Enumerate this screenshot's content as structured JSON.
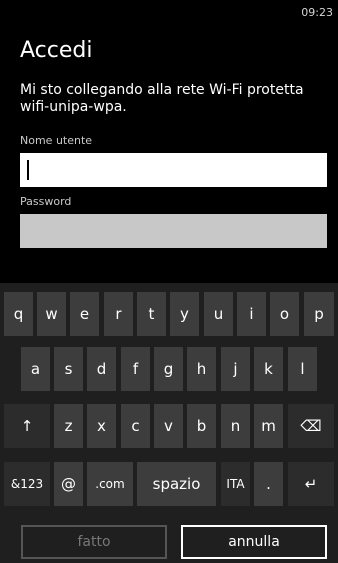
{
  "status": {
    "time": "09:23"
  },
  "title": "Accedi",
  "message": "Mi sto collegando alla rete Wi-Fi protetta wifi-unipa-wpa.",
  "username": {
    "label": "Nome utente",
    "value": ""
  },
  "password": {
    "label": "Password",
    "value": ""
  },
  "keyboard": {
    "row1": [
      "q",
      "w",
      "e",
      "r",
      "t",
      "y",
      "u",
      "i",
      "o",
      "p"
    ],
    "row2": [
      "a",
      "s",
      "d",
      "f",
      "g",
      "h",
      "j",
      "k",
      "l"
    ],
    "row3": [
      "z",
      "x",
      "c",
      "v",
      "b",
      "n",
      "m"
    ],
    "shift": "↑",
    "backspace": "⌫",
    "symbols": "&123",
    "at": "@",
    "dotcom": ".com",
    "space": "spazio",
    "language": "ITA",
    "period": ".",
    "enter": "↵"
  },
  "buttons": {
    "done": "fatto",
    "cancel": "annulla"
  }
}
